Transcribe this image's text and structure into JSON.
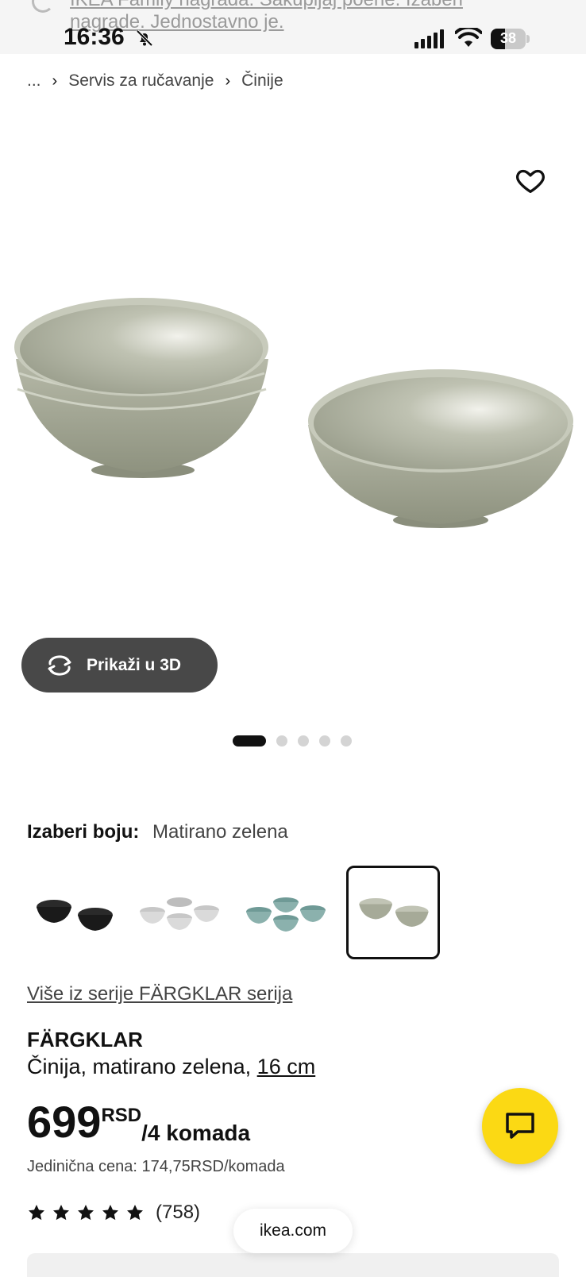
{
  "status_bar": {
    "banner_top": "IKEA Family nagrada: Sakupljaj poene. Izaberi",
    "banner_bottom": "nagrade. Jednostavno je.",
    "time": "16:36",
    "battery": "38"
  },
  "breadcrumb": {
    "ellipsis": "...",
    "items": [
      "Servis za ručavanje",
      "Činije"
    ]
  },
  "gallery": {
    "view_3d_label": "Prikaži u 3D",
    "slide_count": 5,
    "active_slide": 1
  },
  "color_picker": {
    "label": "Izaberi boju:",
    "selected_value": "Matirano zelena",
    "swatches": [
      "black",
      "white",
      "turquoise",
      "matte-green"
    ],
    "selected_index": 3
  },
  "product": {
    "series_link": "Više iz serije FÄRGKLAR serija",
    "name": "FÄRGKLAR",
    "description": "Činija, matirano zelena,",
    "size": "16 cm",
    "price": "699",
    "currency": "RSD",
    "unit": "/4 komada",
    "unit_price": "Jedinična cena: 174,75RSD/komada",
    "rating": 5,
    "review_count": "(758)"
  },
  "browser": {
    "url": "ikea.com"
  },
  "colors": {
    "accent_yellow": "#fbd914",
    "button_dark": "#484848",
    "bowl_green": "#a6aa98"
  }
}
